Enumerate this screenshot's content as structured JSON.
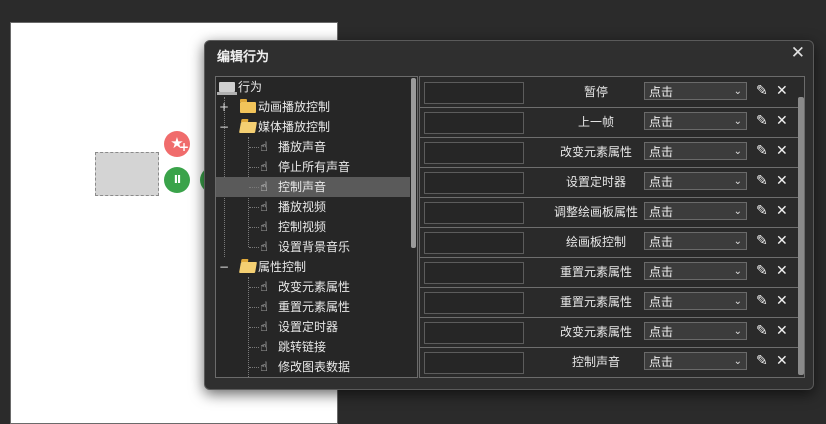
{
  "dialog": {
    "title": "编辑行为",
    "close_symbol": "✕"
  },
  "canvas": {
    "pause_symbol": "II",
    "fav_symbol": "★",
    "fav_plus": "+"
  },
  "tree": {
    "root_label": "行为",
    "items": [
      {
        "label": "动画播放控制",
        "type": "folder",
        "expander": "+"
      },
      {
        "label": "媒体播放控制",
        "type": "folder-open",
        "expander": "−"
      },
      {
        "label": "播放声音",
        "type": "action"
      },
      {
        "label": "停止所有声音",
        "type": "action"
      },
      {
        "label": "控制声音",
        "type": "action",
        "selected": true
      },
      {
        "label": "播放视频",
        "type": "action"
      },
      {
        "label": "控制视频",
        "type": "action"
      },
      {
        "label": "设置背景音乐",
        "type": "action"
      },
      {
        "label": "属性控制",
        "type": "folder-open",
        "expander": "−"
      },
      {
        "label": "改变元素属性",
        "type": "action"
      },
      {
        "label": "重置元素属性",
        "type": "action"
      },
      {
        "label": "设置定时器",
        "type": "action"
      },
      {
        "label": "跳转链接",
        "type": "action"
      },
      {
        "label": "修改图表数据",
        "type": "action"
      }
    ]
  },
  "actions": {
    "rows": [
      {
        "input_value": "",
        "name": "暂停",
        "trigger": "点击"
      },
      {
        "input_value": "",
        "name": "上一帧",
        "trigger": "点击"
      },
      {
        "input_value": "",
        "name": "改变元素属性",
        "trigger": "点击"
      },
      {
        "input_value": "",
        "name": "设置定时器",
        "trigger": "点击"
      },
      {
        "input_value": "",
        "name": "调整绘画板属性",
        "trigger": "点击"
      },
      {
        "input_value": "",
        "name": "绘画板控制",
        "trigger": "点击"
      },
      {
        "input_value": "",
        "name": "重置元素属性",
        "trigger": "点击"
      },
      {
        "input_value": "",
        "name": "重置元素属性",
        "trigger": "点击"
      },
      {
        "input_value": "",
        "name": "改变元素属性",
        "trigger": "点击"
      },
      {
        "input_value": "",
        "name": "控制声音",
        "trigger": "点击"
      }
    ],
    "edit_symbol": "✎",
    "delete_symbol": "✕",
    "dropdown_arrow": "⌄"
  },
  "colors": {
    "accent_red": "#f06c6c",
    "accent_green": "#3aa34a",
    "selected_row": "#5a5a5a"
  }
}
